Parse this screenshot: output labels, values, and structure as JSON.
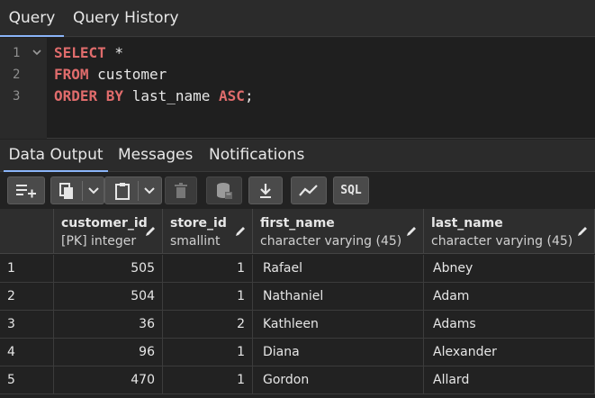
{
  "top_tabs": [
    "Query",
    "Query History"
  ],
  "editor": {
    "line_numbers": [
      "1",
      "2",
      "3"
    ],
    "lines": [
      {
        "kw1": "SELECT",
        "rest": " *",
        "kw2": "",
        "rest2": ""
      },
      {
        "kw1": "FROM",
        "rest": " customer",
        "kw2": "",
        "rest2": ""
      },
      {
        "kw1": "ORDER BY",
        "rest": " last_name ",
        "kw2": "ASC",
        "rest2": ";"
      }
    ]
  },
  "result_tabs": [
    "Data Output",
    "Messages",
    "Notifications"
  ],
  "toolbar": {
    "sql_label": "SQL",
    "icons": [
      "add-row-icon",
      "copy-icon",
      "dropdown-icon",
      "paste-icon",
      "dropdown-icon",
      "delete-icon",
      "save-data-icon",
      "download-icon",
      "graph-icon",
      "sql-icon"
    ]
  },
  "columns": [
    {
      "name": "customer_id",
      "type": "[PK] integer"
    },
    {
      "name": "store_id",
      "type": "smallint"
    },
    {
      "name": "first_name",
      "type": "character varying (45)"
    },
    {
      "name": "last_name",
      "type": "character varying (45)"
    }
  ],
  "rows": [
    {
      "n": "1",
      "customer_id": "505",
      "store_id": "1",
      "first_name": "Rafael",
      "last_name": "Abney"
    },
    {
      "n": "2",
      "customer_id": "504",
      "store_id": "1",
      "first_name": "Nathaniel",
      "last_name": "Adam"
    },
    {
      "n": "3",
      "customer_id": "36",
      "store_id": "2",
      "first_name": "Kathleen",
      "last_name": "Adams"
    },
    {
      "n": "4",
      "customer_id": "96",
      "store_id": "1",
      "first_name": "Diana",
      "last_name": "Alexander"
    },
    {
      "n": "5",
      "customer_id": "470",
      "store_id": "1",
      "first_name": "Gordon",
      "last_name": "Allard"
    }
  ]
}
